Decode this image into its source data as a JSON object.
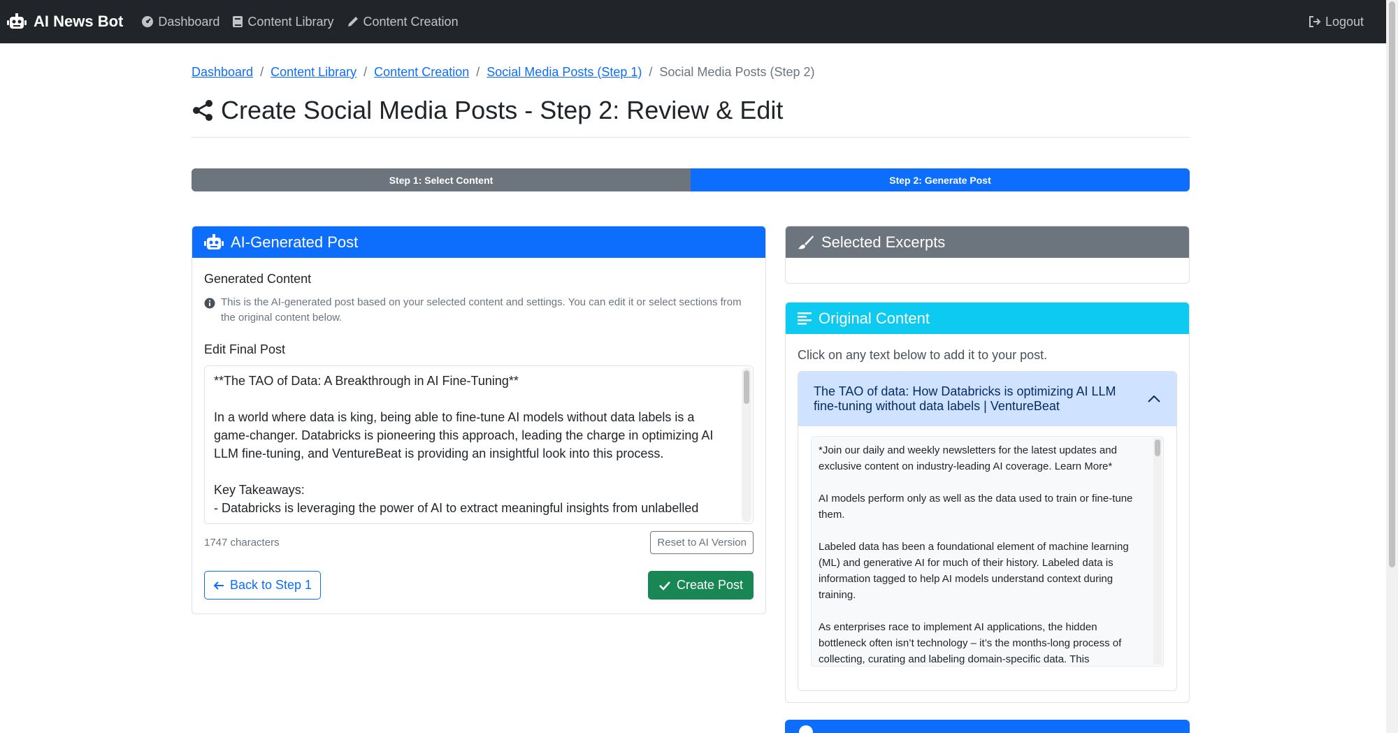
{
  "navbar": {
    "brand": "AI News Bot",
    "links": [
      "Dashboard",
      "Content Library",
      "Content Creation"
    ],
    "logout": "Logout"
  },
  "breadcrumb": {
    "items": [
      "Dashboard",
      "Content Library",
      "Content Creation",
      "Social Media Posts (Step 1)"
    ],
    "active": "Social Media Posts (Step 2)"
  },
  "page": {
    "title": "Create Social Media Posts - Step 2: Review & Edit"
  },
  "steps": [
    "Step 1: Select Content",
    "Step 2: Generate Post"
  ],
  "ai_post": {
    "header": "AI-Generated Post",
    "generated_label": "Generated Content",
    "help_text": "This is the AI-generated post based on your selected content and settings. You can edit it or select sections from the original content below.",
    "edit_label": "Edit Final Post",
    "post_text": "**The TAO of Data: A Breakthrough in AI Fine-Tuning**\n\nIn a world where data is king, being able to fine-tune AI models without data labels is a game-changer. Databricks is pioneering this approach, leading the charge in optimizing AI LLM fine-tuning, and VentureBeat is providing an insightful look into this process.\n\nKey Takeaways:\n- Databricks is leveraging the power of AI to extract meaningful insights from unlabelled",
    "char_count": "1747 characters",
    "reset_label": "Reset to AI Version",
    "back_label": "Back to Step 1",
    "create_label": "Create Post"
  },
  "excerpts": {
    "header": "Selected Excerpts"
  },
  "original": {
    "header": "Original Content",
    "hint": "Click on any text below to add it to your post.",
    "article_title": "The TAO of data: How Databricks is optimizing  AI LLM fine-tuning without data labels | VentureBeat",
    "paragraphs": [
      "*Join our daily and weekly newsletters for the latest updates and exclusive content on industry-leading AI coverage. Learn More*",
      "AI models perform only as well as the data used to train or fine-tune them.",
      "Labeled data has been a foundational element of machine learning (ML) and generative AI for much of their history. Labeled data is information tagged to help AI models understand context during training.",
      "As enterprises race to implement AI applications, the hidden bottleneck often isn’t technology – it’s the months-long process of collecting, curating and labeling domain-specific data. This"
    ]
  },
  "colors": {
    "navbar": "#212529",
    "primary": "#0d6efd",
    "secondary": "#6c757d",
    "info": "#0dcaf0",
    "success": "#198754"
  },
  "icons": [
    "robot-icon",
    "dashboard-gauge-icon",
    "book-icon",
    "pencil-icon",
    "logout-icon",
    "share-icon",
    "info-circle-icon",
    "arrow-left-icon",
    "check-icon",
    "brush-icon",
    "align-left-icon",
    "chevron-up-icon"
  ]
}
